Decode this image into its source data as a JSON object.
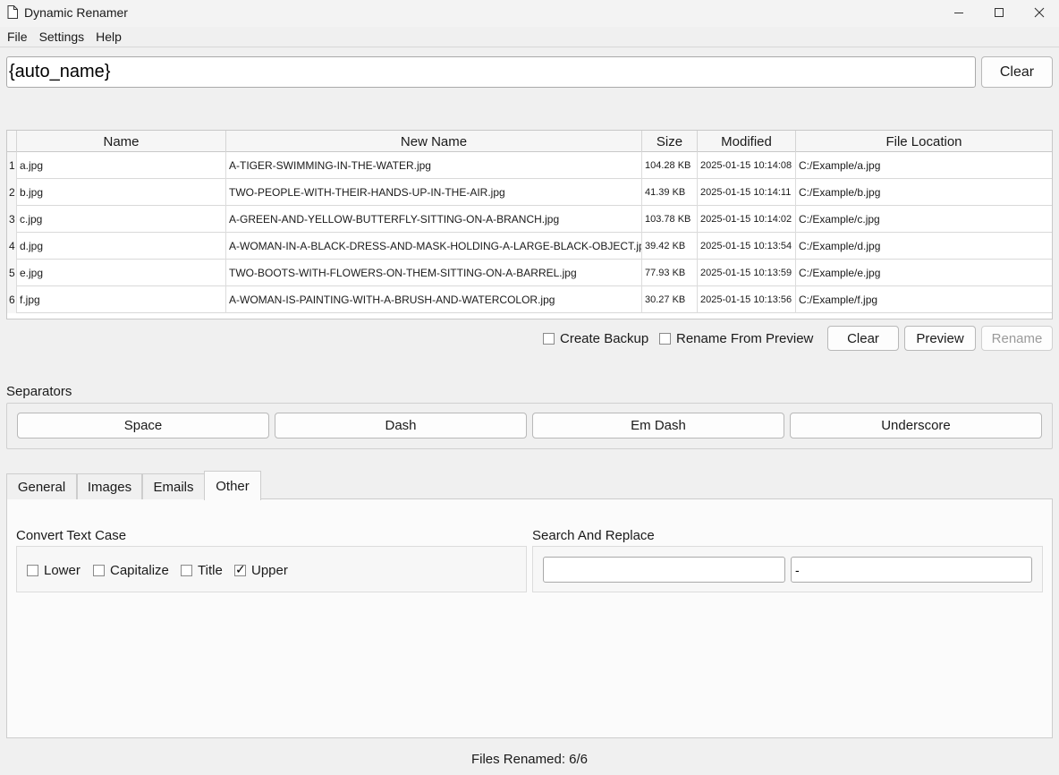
{
  "window": {
    "title": "Dynamic Renamer",
    "min_glyph": "—",
    "max_glyph": "☐",
    "close_glyph": "✕"
  },
  "menu": [
    "File",
    "Settings",
    "Help"
  ],
  "pattern": {
    "value": "{auto_name}",
    "clear_label": "Clear"
  },
  "table": {
    "headers": [
      "Name",
      "New Name",
      "Size",
      "Modified",
      "File Location"
    ],
    "rows": [
      {
        "num": "1",
        "name": "a.jpg",
        "new_name": "A-TIGER-SWIMMING-IN-THE-WATER.jpg",
        "size": "104.28 KB",
        "modified": "2025-01-15 10:14:08",
        "location": "C:/Example/a.jpg"
      },
      {
        "num": "2",
        "name": "b.jpg",
        "new_name": "TWO-PEOPLE-WITH-THEIR-HANDS-UP-IN-THE-AIR.jpg",
        "size": "41.39 KB",
        "modified": "2025-01-15 10:14:11",
        "location": "C:/Example/b.jpg"
      },
      {
        "num": "3",
        "name": "c.jpg",
        "new_name": "A-GREEN-AND-YELLOW-BUTTERFLY-SITTING-ON-A-BRANCH.jpg",
        "size": "103.78 KB",
        "modified": "2025-01-15 10:14:02",
        "location": "C:/Example/c.jpg"
      },
      {
        "num": "4",
        "name": "d.jpg",
        "new_name": "A-WOMAN-IN-A-BLACK-DRESS-AND-MASK-HOLDING-A-LARGE-BLACK-OBJECT.jpg",
        "size": "39.42 KB",
        "modified": "2025-01-15 10:13:54",
        "location": "C:/Example/d.jpg"
      },
      {
        "num": "5",
        "name": "e.jpg",
        "new_name": "TWO-BOOTS-WITH-FLOWERS-ON-THEM-SITTING-ON-A-BARREL.jpg",
        "size": "77.93 KB",
        "modified": "2025-01-15 10:13:59",
        "location": "C:/Example/e.jpg"
      },
      {
        "num": "6",
        "name": "f.jpg",
        "new_name": "A-WOMAN-IS-PAINTING-WITH-A-BRUSH-AND-WATERCOLOR.jpg",
        "size": "30.27 KB",
        "modified": "2025-01-15 10:13:56",
        "location": "C:/Example/f.jpg"
      }
    ]
  },
  "actions": {
    "create_backup": {
      "label": "Create Backup",
      "checked": false
    },
    "rename_from_preview": {
      "label": "Rename From Preview",
      "checked": false
    },
    "clear_label": "Clear",
    "preview_label": "Preview",
    "rename_label": "Rename"
  },
  "separators": {
    "label": "Separators",
    "buttons": [
      "Space",
      "Dash",
      "Em Dash",
      "Underscore"
    ]
  },
  "tabs": {
    "items": [
      "General",
      "Images",
      "Emails",
      "Other"
    ],
    "active": "Other"
  },
  "other": {
    "case_label": "Convert Text Case",
    "case_options": [
      {
        "label": "Lower",
        "checked": false
      },
      {
        "label": "Capitalize",
        "checked": false
      },
      {
        "label": "Title",
        "checked": false
      },
      {
        "label": "Upper",
        "checked": true
      }
    ],
    "search_replace_label": "Search And Replace",
    "search_value": "",
    "replace_value": "-"
  },
  "status": "Files Renamed: 6/6"
}
